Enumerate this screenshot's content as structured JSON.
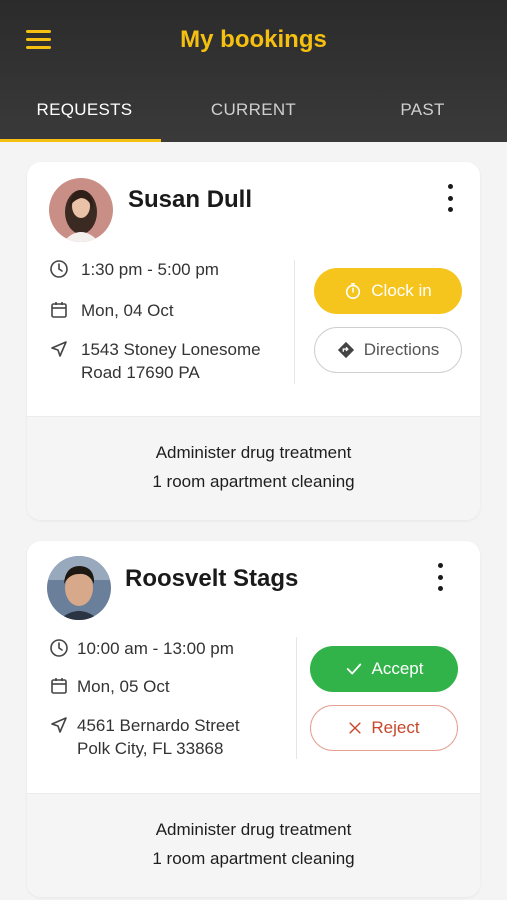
{
  "header": {
    "title": "My bookings",
    "menu_icon": "hamburger-menu-icon",
    "accent_color": "#f5c00f"
  },
  "tabs": [
    {
      "label": "REQUESTS",
      "active": true
    },
    {
      "label": "CURRENT",
      "active": false
    },
    {
      "label": "PAST",
      "active": false
    }
  ],
  "bookings": [
    {
      "name": "Susan Dull",
      "time": "1:30 pm - 5:00 pm",
      "date": "Mon, 04 Oct",
      "address_line1": "1543 Stoney Lonesome",
      "address_line2": "Road 17690 PA",
      "primary_action": {
        "label": "Clock in",
        "icon": "stopwatch-icon",
        "color": "#f5c51e"
      },
      "secondary_action": {
        "label": "Directions",
        "icon": "directions-icon"
      },
      "services": [
        "Administer drug treatment",
        "1 room apartment cleaning"
      ]
    },
    {
      "name": "Roosvelt Stags",
      "time": "10:00 am - 13:00 pm",
      "date": "Mon, 05 Oct",
      "address_line1": "4561 Bernardo Street",
      "address_line2": "Polk City, FL 33868",
      "primary_action": {
        "label": "Accept",
        "icon": "checkmark-icon",
        "color": "#32b34a"
      },
      "secondary_action": {
        "label": "Reject",
        "icon": "x-icon",
        "color": "#c7472a"
      },
      "services": [
        "Administer drug treatment",
        "1 room apartment cleaning"
      ]
    }
  ]
}
